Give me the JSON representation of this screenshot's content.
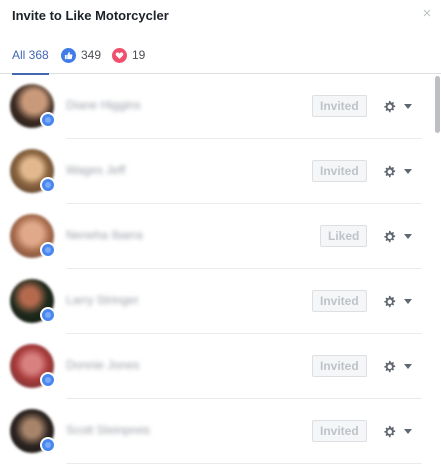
{
  "dialog": {
    "title": "Invite to Like Motorcycler",
    "close_glyph": "×"
  },
  "tabs": [
    {
      "label": "All 368"
    },
    {
      "count": "349",
      "icon": "like-icon"
    },
    {
      "count": "19",
      "icon": "love-icon"
    }
  ],
  "people": [
    {
      "name": "Diane Higgins",
      "status": "Invited"
    },
    {
      "name": "Wages Jeff",
      "status": "Invited"
    },
    {
      "name": "Neneha Ibarra",
      "status": "Liked"
    },
    {
      "name": "Larry Stringer",
      "status": "Invited"
    },
    {
      "name": "Donnie Jones",
      "status": "Invited"
    },
    {
      "name": "Scott Steinpreis",
      "status": "Invited"
    }
  ],
  "colors": {
    "accent": "#4267b2",
    "like": "#3f7ce8",
    "love": "#f0506e"
  }
}
